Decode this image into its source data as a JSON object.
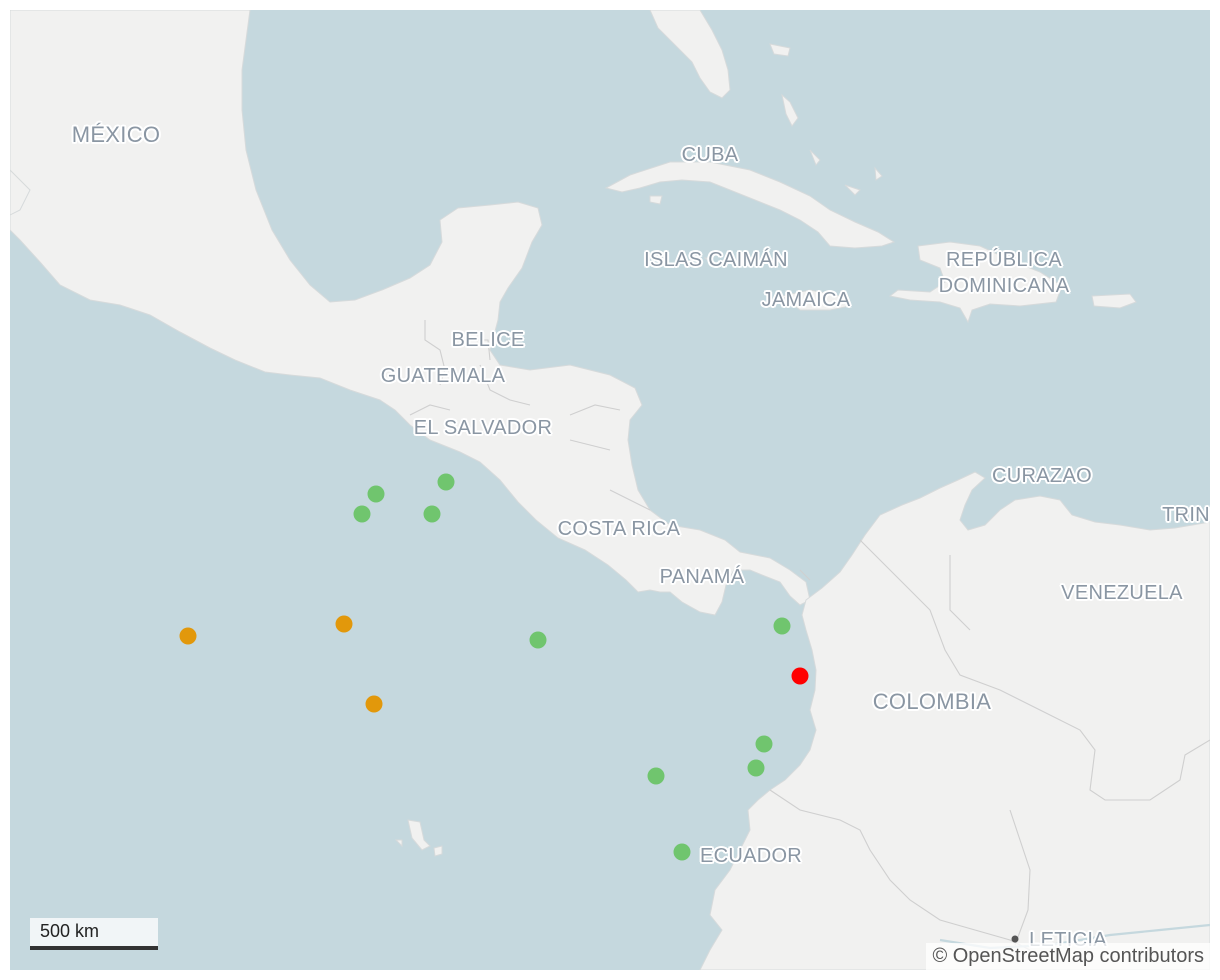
{
  "map": {
    "countries": [
      {
        "name": "MÉXICO",
        "key": "mexico"
      },
      {
        "name": "CUBA",
        "key": "cuba"
      },
      {
        "name": "ISLAS CAIMÁN",
        "key": "cayman"
      },
      {
        "name": "JAMAICA",
        "key": "jamaica"
      },
      {
        "name": "REPÚBLICA\nDOMINICANA",
        "key": "dominican-republic"
      },
      {
        "name": "BELICE",
        "key": "belize"
      },
      {
        "name": "GUATEMALA",
        "key": "guatemala"
      },
      {
        "name": "EL SALVADOR",
        "key": "el-salvador"
      },
      {
        "name": "CURAZAO",
        "key": "curacao"
      },
      {
        "name": "TRIN",
        "key": "trinidad"
      },
      {
        "name": "COSTA RICA",
        "key": "costa-rica"
      },
      {
        "name": "PANAMÁ",
        "key": "panama"
      },
      {
        "name": "VENEZUELA",
        "key": "venezuela"
      },
      {
        "name": "COLOMBIA",
        "key": "colombia"
      },
      {
        "name": "ECUADOR",
        "key": "ecuador"
      },
      {
        "name": "LETICIA",
        "key": "leticia"
      }
    ],
    "markers": [
      {
        "status": "green",
        "color": "#70c56e"
      },
      {
        "status": "green",
        "color": "#70c56e"
      },
      {
        "status": "green",
        "color": "#70c56e"
      },
      {
        "status": "green",
        "color": "#70c56e"
      },
      {
        "status": "orange",
        "color": "#e2980b"
      },
      {
        "status": "orange",
        "color": "#e2980b"
      },
      {
        "status": "orange",
        "color": "#e2980b"
      },
      {
        "status": "green",
        "color": "#70c56e"
      },
      {
        "status": "green",
        "color": "#70c56e"
      },
      {
        "status": "red",
        "color": "#ff0000"
      },
      {
        "status": "green",
        "color": "#70c56e"
      },
      {
        "status": "green",
        "color": "#70c56e"
      },
      {
        "status": "green",
        "color": "#70c56e"
      },
      {
        "status": "green",
        "color": "#70c56e"
      }
    ],
    "colors": {
      "water": "#c5d8de",
      "land": "#f1f1f0",
      "label": "#8a96a3"
    }
  },
  "scale": {
    "label": "500 km"
  },
  "attribution": {
    "text": "© OpenStreetMap contributors"
  }
}
